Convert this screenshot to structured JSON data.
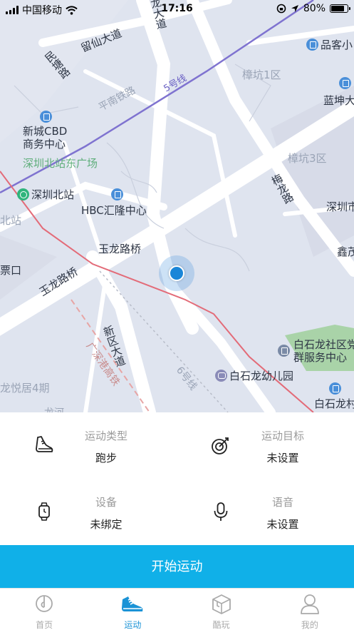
{
  "status_bar": {
    "carrier": "中国移动",
    "time": "17:16",
    "battery": "80%",
    "battery_level": 0.8
  },
  "map": {
    "labels": {
      "liuxian": "留仙大道",
      "minsai": "民塘路",
      "longda": "龙大道",
      "pinke": "品客小",
      "zhangkeng1": "樟坑1区",
      "pingnan": "平南铁路",
      "line5": "5号线",
      "lankun": "蓝坤大",
      "xincheng": "新城CBD\n商务中心",
      "north_square": "深圳北站东广场",
      "zhangkeng3": "樟坑3区",
      "meilong": "梅龙路",
      "shenzhen_north": "深圳北站",
      "beizhan": "北站",
      "hbc": "HBC汇隆中心",
      "shenzhen_city": "深圳市",
      "xinchong": "鑫茂",
      "yulong_bridge": "玉龙路桥",
      "piaokou": "票口",
      "yulong_bridge2": "玉龙路桥",
      "xinqu": "新区大道",
      "guangshen": "广深港高铁",
      "baishilong_community": "白石龙社区党\n群服务中心",
      "baishilong_kindergarten": "白石龙幼儿园",
      "line6": "6号线",
      "baishilong_village": "白石龙村",
      "longyueju": "龙悦居4期",
      "longhe": "龙河"
    }
  },
  "settings": {
    "sport_type_label": "运动类型",
    "sport_type_value": "跑步",
    "sport_goal_label": "运动目标",
    "sport_goal_value": "未设置",
    "device_label": "设备",
    "device_value": "未绑定",
    "voice_label": "语音",
    "voice_value": "未设置"
  },
  "start_button": "开始运动",
  "tabs": [
    {
      "label": "首页",
      "icon": "home-icon"
    },
    {
      "label": "运动",
      "icon": "shoe-icon"
    },
    {
      "label": "酷玩",
      "icon": "cube-icon"
    },
    {
      "label": "我的",
      "icon": "profile-icon"
    }
  ],
  "colors": {
    "accent": "#10b0e8",
    "tab_active": "#1b93d6",
    "location_dot": "#1a86d8"
  }
}
